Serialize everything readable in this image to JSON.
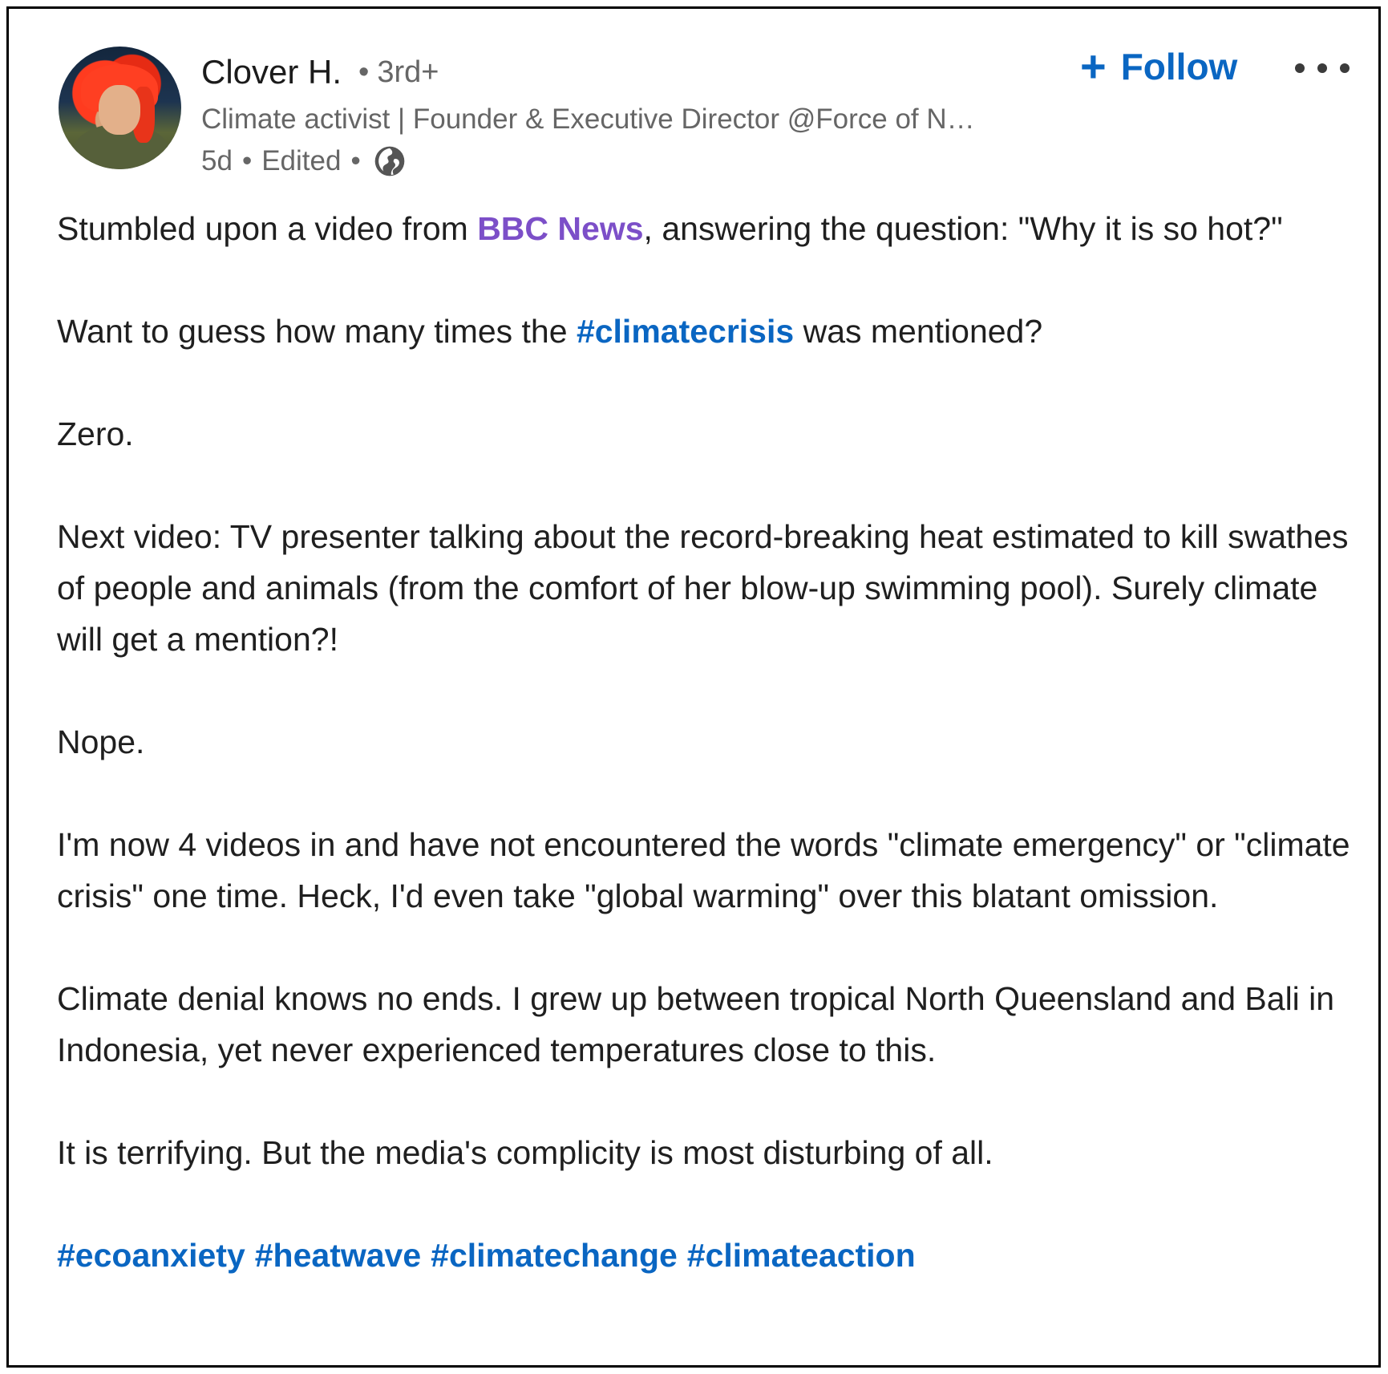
{
  "post": {
    "author": {
      "name": "Clover H.",
      "degree": "3rd+",
      "headline": "Climate activist | Founder & Executive Director @Force of N…",
      "time": "5d",
      "edited": "Edited",
      "visibility_icon": "globe-icon"
    },
    "actions": {
      "follow_icon": "plus-icon",
      "follow_label": "Follow",
      "more_icon": "more-horizontal-icon"
    },
    "body": {
      "p1_before": "Stumbled upon a video from ",
      "p1_link": "BBC News",
      "p1_after": ", answering the question: \"Why it is so hot?\"",
      "p2_before": "Want to guess how many times the ",
      "p2_hashtag": "#climatecrisis",
      "p2_after": " was mentioned?",
      "p3": "Zero.",
      "p4": "Next video: TV presenter talking about the record-breaking heat estimated to kill swathes of people and animals (from the comfort of her blow-up swimming pool). Surely climate will get a mention?!",
      "p5": "Nope.",
      "p6": "I'm now 4 videos in and have not encountered the words \"climate emergency\" or \"climate crisis\" one time. Heck, I'd even take \"global warming\" over this blatant omission.",
      "p7": "Climate denial knows no ends. I grew up between tropical North Queensland and Bali in Indonesia, yet never experienced temperatures close to this.",
      "p8": "It is terrifying. But the media's complicity is most disturbing of all.",
      "hashtags": [
        "#ecoanxiety",
        "#heatwave",
        "#climatechange",
        "#climateaction"
      ]
    },
    "colors": {
      "link_blue": "#0a66c2",
      "link_purple": "#7c4fc8",
      "muted_text": "#666666"
    }
  }
}
